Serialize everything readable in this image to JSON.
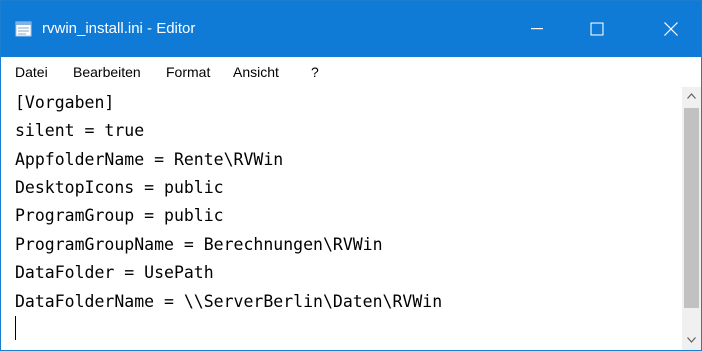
{
  "window": {
    "title": "rvwin_install.ini - Editor"
  },
  "menu": {
    "items": [
      "Datei",
      "Bearbeiten",
      "Format",
      "Ansicht",
      "?"
    ]
  },
  "editor": {
    "lines": [
      "[Vorgaben]",
      "silent = true",
      "AppfolderName = Rente\\RVWin",
      "DesktopIcons = public",
      "ProgramGroup = public",
      "ProgramGroupName = Berechnungen\\RVWin",
      "DataFolder = UsePath",
      "DataFolderName = \\\\ServerBerlin\\Daten\\RVWin"
    ]
  },
  "colors": {
    "titlebar": "#0f7bd7",
    "scrollbar_track": "#f0f0f0",
    "scrollbar_thumb": "#c1c1c1"
  },
  "icons": {
    "app": "notepad-icon",
    "minimize": "minimize-icon",
    "maximize": "maximize-icon",
    "close": "close-icon",
    "scroll_up": "chevron-up-icon",
    "scroll_down": "chevron-down-icon"
  }
}
